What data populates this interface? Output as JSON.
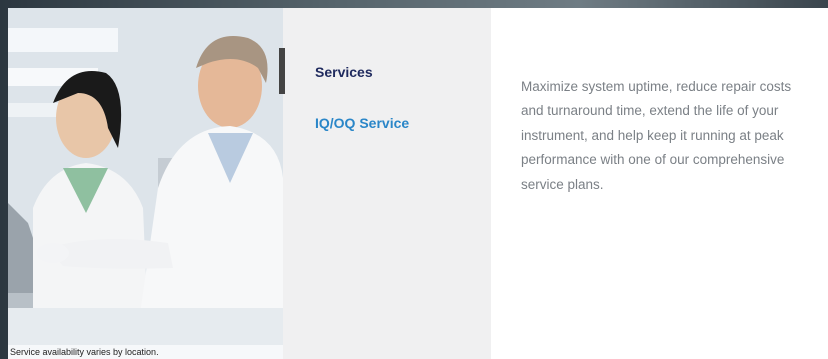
{
  "photo": {
    "caption": "Service availability varies by location."
  },
  "nav": {
    "items": [
      {
        "label": "Services",
        "active": true
      },
      {
        "label": "IQ/OQ Service",
        "active": false
      }
    ]
  },
  "content": {
    "description": "Maximize system uptime, reduce repair costs and turnaround time, extend the life of your instrument, and help keep it running at peak performance with one of our comprehensive service plans."
  },
  "colors": {
    "active_nav": "#1f2a5e",
    "link_nav": "#2a86c8",
    "nav_bg": "#f0f0f1",
    "body_text": "#7b8086"
  }
}
